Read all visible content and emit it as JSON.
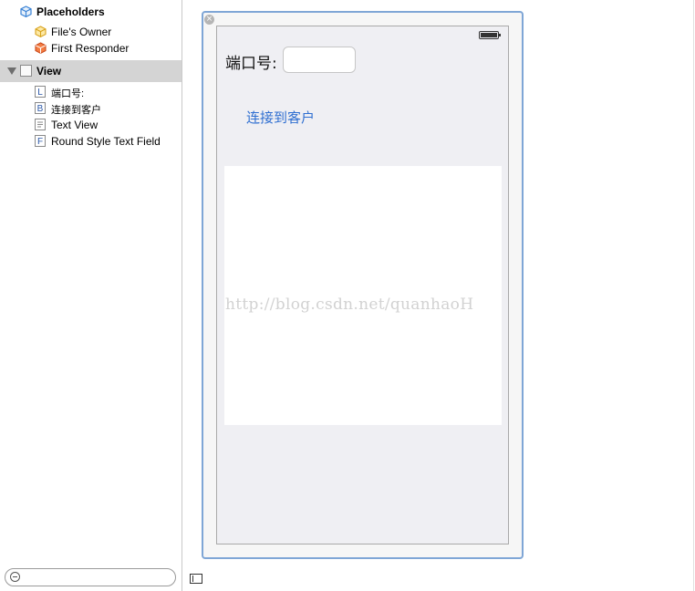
{
  "outline": {
    "placeholders_label": "Placeholders",
    "files_owner_label": "File's Owner",
    "first_responder_label": "First Responder",
    "view_label": "View",
    "children": [
      {
        "badge": "L",
        "label": "端口号:"
      },
      {
        "badge": "B",
        "label": "连接到客户"
      },
      {
        "badge": "",
        "label": "Text View"
      },
      {
        "badge": "F",
        "label": "Round Style Text Field"
      }
    ]
  },
  "scene": {
    "close_glyph": "×",
    "port_label": "端口号:",
    "port_field_value": "",
    "connect_button_label": "连接到客户",
    "watermark": "http://blog.csdn.net/quanhaoH"
  },
  "colors": {
    "selection": "#d4d4d4",
    "button_text": "#2f6fd1",
    "scene_border": "#7fa6d6"
  }
}
